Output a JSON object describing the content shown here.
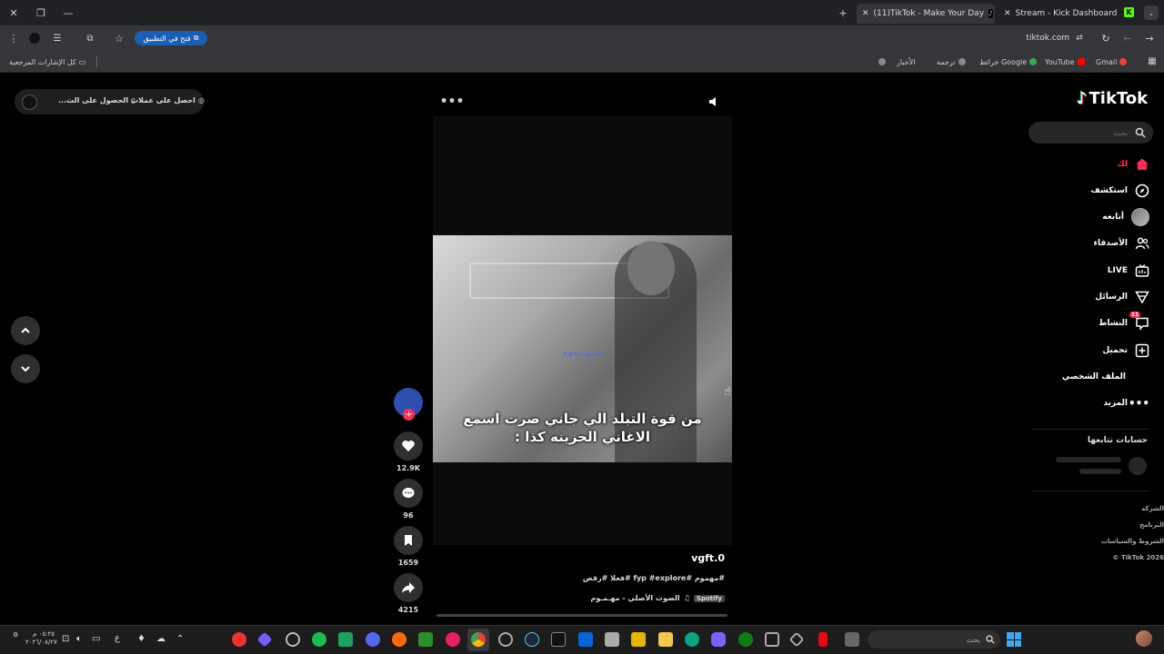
{
  "browser": {
    "tabs": [
      {
        "title": "(11)TikTok - Make Your Day",
        "active": true
      },
      {
        "title": "Stream - Kick Dashboard",
        "active": false
      }
    ],
    "url": "tiktok.com",
    "open_in_app": "فتح في التطبيق",
    "bookmarks": [
      "Gmail",
      "YouTube",
      "خرائط Google",
      "ترجمة",
      "الأخبار"
    ],
    "all_bookmarks": "كل الإشارات المرجعية"
  },
  "tiktok": {
    "logo": "TikTok",
    "search_placeholder": "بحث",
    "nav": [
      {
        "label": "لك",
        "icon": "home-icon",
        "color": "#fe2c55"
      },
      {
        "label": "استكشف",
        "icon": "compass-icon"
      },
      {
        "label": "أتابعه",
        "icon": "following-avatar-icon"
      },
      {
        "label": "الأصدقاء",
        "icon": "friends-icon"
      },
      {
        "label": "LIVE",
        "icon": "live-icon"
      },
      {
        "label": "الرسائل",
        "icon": "messages-icon"
      },
      {
        "label": "النشاط",
        "icon": "activity-icon",
        "badge": "11"
      },
      {
        "label": "تحميل",
        "icon": "upload-icon"
      },
      {
        "label": "الملف الشخصي",
        "icon": "profile-icon"
      },
      {
        "label": "المزيد",
        "icon": "more-icon"
      }
    ],
    "following_title": "حسابات تتابعها",
    "footer_links": [
      "الشركة",
      "البرنامج",
      "الشروط والسياسات",
      "TikTok 2026 ©"
    ],
    "top_pill": {
      "coins": "احصل على عملات",
      "get_app": "الحصول على الت..."
    }
  },
  "video": {
    "caption_line1": "من قوة التبلد الي جاني صرت اسمع",
    "caption_line2": "الاغاني الحزينه كذا :",
    "watermark": "مـــهـــموم",
    "username": "vgft.0",
    "hashtags": "#مهموم #fyp #explore #فعلا #رقص",
    "music": "الصوت الأصلي - مهـمـوم",
    "music_source": "Spotify",
    "likes": "12.9K",
    "comments": "96",
    "saves": "1659",
    "shares": "4215"
  },
  "taskbar": {
    "search_placeholder": "بحث",
    "time": "٠٥:٢٥ م",
    "date": "٢٠٢٦/٠٨/٢٧",
    "lang": "ع"
  }
}
